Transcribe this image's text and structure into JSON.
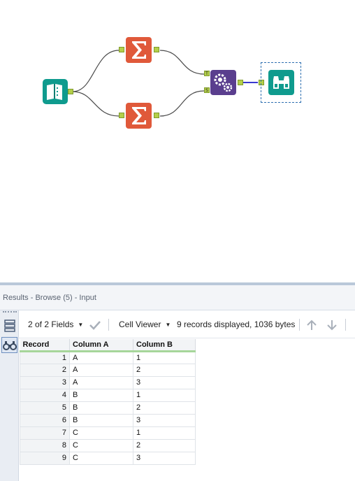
{
  "results": {
    "title": "Results - Browse (5) - Input",
    "fields_label": "2 of 2 Fields",
    "viewer_label": "Cell Viewer",
    "records_info": "9 records displayed, 1036 bytes",
    "columns": [
      "Record",
      "Column A",
      "Column B"
    ],
    "rows": [
      {
        "rec": "1",
        "a": "A",
        "b": "1"
      },
      {
        "rec": "2",
        "a": "A",
        "b": "2"
      },
      {
        "rec": "3",
        "a": "A",
        "b": "3"
      },
      {
        "rec": "4",
        "a": "B",
        "b": "1"
      },
      {
        "rec": "5",
        "a": "B",
        "b": "2"
      },
      {
        "rec": "6",
        "a": "B",
        "b": "3"
      },
      {
        "rec": "7",
        "a": "C",
        "b": "1"
      },
      {
        "rec": "8",
        "a": "C",
        "b": "2"
      },
      {
        "rec": "9",
        "a": "C",
        "b": "3"
      }
    ]
  },
  "workflow": {
    "tools": [
      {
        "name": "input-data-tool",
        "icon": "book-icon",
        "color": "#0f9b8e"
      },
      {
        "name": "summarize-tool-top",
        "icon": "sigma-icon",
        "color": "#e0593a"
      },
      {
        "name": "summarize-tool-bottom",
        "icon": "sigma-icon",
        "color": "#e0593a"
      },
      {
        "name": "append-fields-tool",
        "icon": "gears-icon",
        "color": "#5a3e8e"
      },
      {
        "name": "browse-tool",
        "icon": "binoculars-icon",
        "color": "#0f9b8e"
      }
    ],
    "anchor_labels": {
      "target": "T",
      "source": "S"
    },
    "selected_tool": "browse-tool"
  }
}
